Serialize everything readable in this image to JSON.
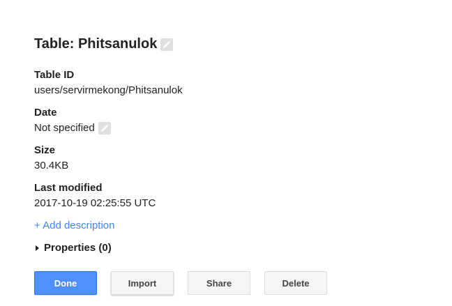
{
  "table": {
    "title": "Table: Phitsanulok",
    "edit_icon": "pencil-icon"
  },
  "fields": {
    "table_id": {
      "label": "Table ID",
      "value": "users/servirmekong/Phitsanulok"
    },
    "date": {
      "label": "Date",
      "value": "Not specified",
      "edit_icon": "pencil-icon"
    },
    "size": {
      "label": "Size",
      "value": "30.4KB"
    },
    "last_modified": {
      "label": "Last modified",
      "value": "2017-10-19 02:25:55 UTC"
    }
  },
  "add_description": "+ Add description",
  "properties": {
    "label": "Properties (0)",
    "expand_icon": "triangle-right-icon"
  },
  "buttons": {
    "done": "Done",
    "import": "Import",
    "share": "Share",
    "delete": "Delete"
  },
  "colors": {
    "primary_button": "#4d90fe",
    "link": "#4285f4",
    "icon_gray": "#bdbdbd"
  }
}
